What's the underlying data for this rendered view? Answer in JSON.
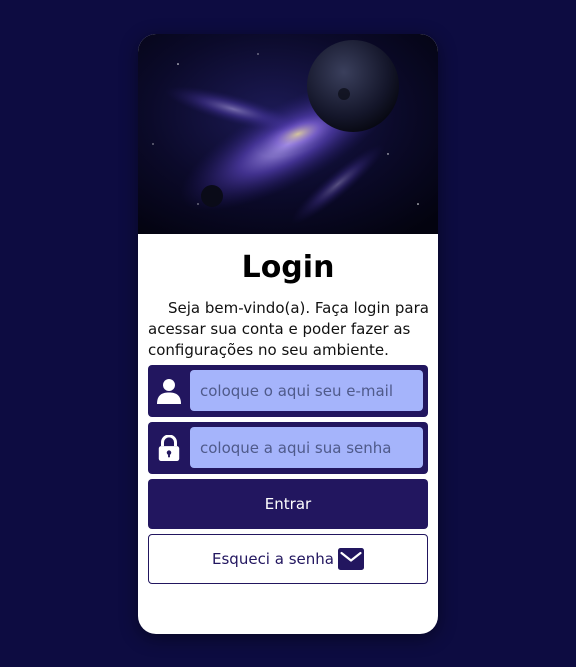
{
  "login": {
    "title": "Login",
    "welcome_text": "Seja bem-vindo(a). Faça login para acessar sua conta e poder fazer as configurações no seu ambiente.",
    "email_placeholder": "coloque o aqui seu e-mail",
    "email_value": "",
    "password_placeholder": "coloque a aqui sua senha",
    "password_value": "",
    "submit_label": "Entrar",
    "forgot_label": "Esqueci a senha"
  },
  "icons": {
    "email_field": "user-icon",
    "password_field": "lock-icon",
    "forgot_button": "envelope-icon"
  },
  "colors": {
    "page_background": "#0d0c41",
    "primary": "#22165f",
    "input_background": "#a5b4fb",
    "card_background": "#ffffff"
  }
}
